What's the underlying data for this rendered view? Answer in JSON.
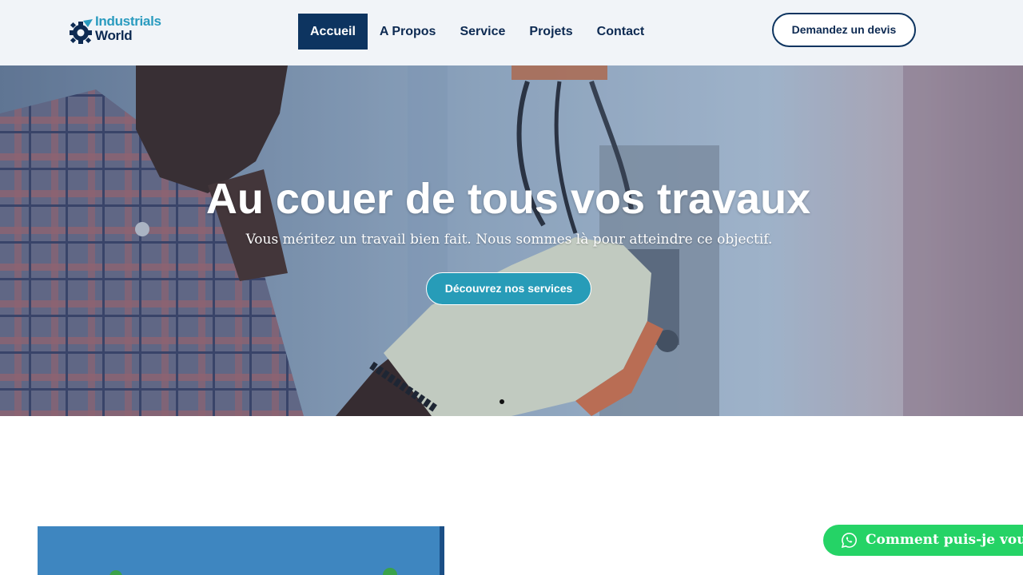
{
  "brand": {
    "line1": "Industrials",
    "line2": "World",
    "colors": {
      "primary": "#0d3460",
      "accent": "#279cb8",
      "whatsapp": "#25d366"
    }
  },
  "nav": {
    "items": [
      {
        "label": "Accueil",
        "active": true
      },
      {
        "label": "A Propos",
        "active": false
      },
      {
        "label": "Service",
        "active": false
      },
      {
        "label": "Projets",
        "active": false
      },
      {
        "label": "Contact",
        "active": false
      }
    ],
    "quote_button": "Demandez un devis"
  },
  "hero": {
    "title": "Au couer de tous vos travaux",
    "subtitle": "Vous méritez un travail bien fait. Nous sommes là pour atteindre ce objectif.",
    "cta": "Découvrez nos services"
  },
  "whatsapp": {
    "label": "Comment puis-je vous",
    "icon": "whatsapp-icon"
  }
}
